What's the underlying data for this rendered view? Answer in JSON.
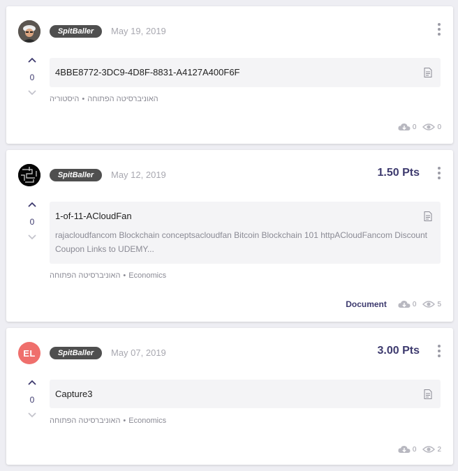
{
  "posts": [
    {
      "avatar": "profile-photo",
      "author": "SpitBaller",
      "date": "May 19, 2019",
      "points": "",
      "votes": "0",
      "title": "4BBE8772-3DC9-4D8F-8831-A4127A400F6F",
      "preview": "",
      "university": "האוניברסיטה הפתוחה",
      "course": "היסטוריה",
      "type": "",
      "downloads": "0",
      "views": "0"
    },
    {
      "avatar": "dark-maze-image",
      "author": "SpitBaller",
      "date": "May 12, 2019",
      "points": "1.50 Pts",
      "votes": "0",
      "title": "1-of-11-ACloudFan",
      "preview": "rajacloudfancom Blockchain conceptsacloudfan Bitcoin Blockchain 101 httpACloudFancom Discount Coupon Links to UDEMY...",
      "university": "האוניברסיטה הפתוחה",
      "course": "Economics",
      "type": "Document",
      "downloads": "0",
      "views": "5"
    },
    {
      "avatar_initials": "EL",
      "author": "SpitBaller",
      "date": "May 07, 2019",
      "points": "3.00 Pts",
      "votes": "0",
      "title": "Capture3",
      "preview": "",
      "university": "האוניברסיטה הפתוחה",
      "course": "Economics",
      "type": "",
      "downloads": "0",
      "views": "2"
    }
  ],
  "icons": {
    "upvote": "chevron-up-icon",
    "downvote": "chevron-down-icon",
    "menu": "more-vertical-icon",
    "doc": "document-icon",
    "download": "cloud-download-icon",
    "views": "eye-icon"
  },
  "colors": {
    "accent": "#3d3a6e",
    "badge": "#4f4f4f",
    "avatar_el": "#ef6f6c",
    "muted": "#9c9ca6"
  }
}
